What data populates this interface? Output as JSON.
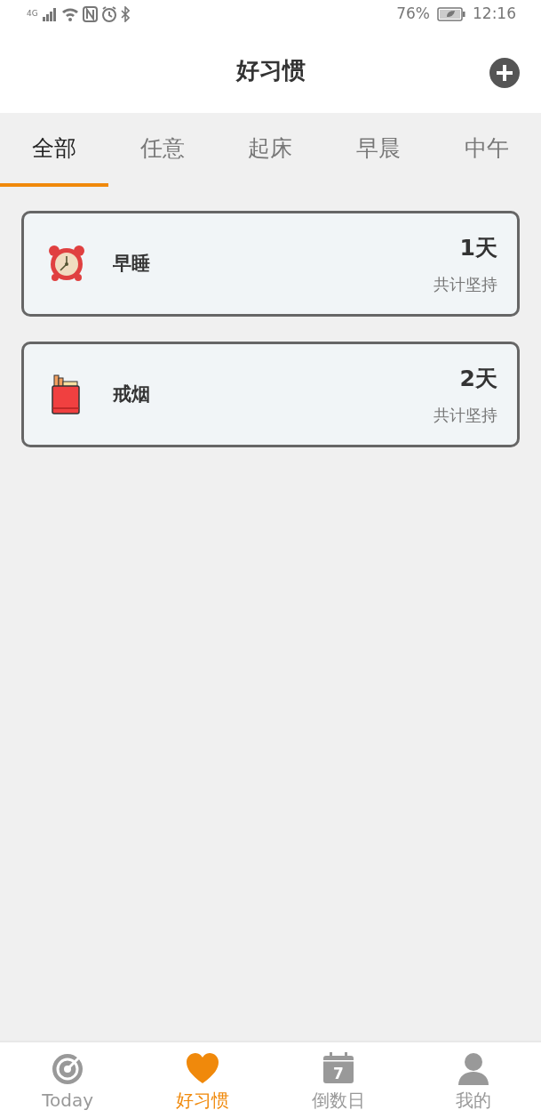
{
  "status_bar": {
    "network": "4G",
    "battery": "76%",
    "time": "12:16"
  },
  "header": {
    "title": "好习惯"
  },
  "tabs": [
    {
      "label": "全部",
      "selected": true
    },
    {
      "label": "任意",
      "selected": false
    },
    {
      "label": "起床",
      "selected": false
    },
    {
      "label": "早晨",
      "selected": false
    },
    {
      "label": "中午",
      "selected": false
    }
  ],
  "habits": [
    {
      "kind": "alarm-clock",
      "name": "早睡",
      "days": "1天",
      "caption": "共计坚持"
    },
    {
      "kind": "cigarettes",
      "name": "戒烟",
      "days": "2天",
      "caption": "共计坚持"
    }
  ],
  "bottom_nav": [
    {
      "kind": "target",
      "label": "Today",
      "selected": false
    },
    {
      "kind": "heart",
      "label": "好习惯",
      "selected": true
    },
    {
      "kind": "calendar",
      "label": "倒数日",
      "selected": false,
      "icon_text": "7"
    },
    {
      "kind": "person",
      "label": "我的",
      "selected": false
    }
  ]
}
